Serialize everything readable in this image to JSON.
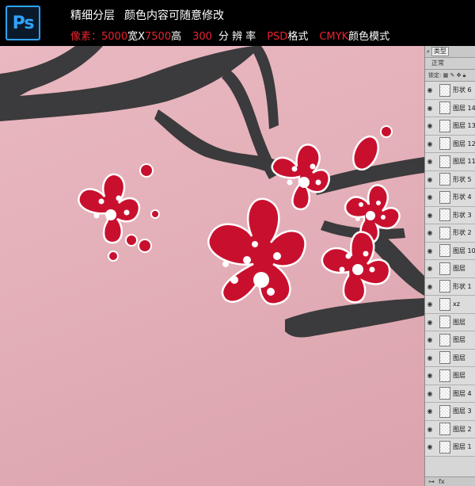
{
  "header": {
    "app_logo": "Ps",
    "title_1": "精细分层",
    "title_2": "颜色内容可随意修改",
    "pixels_label": "像素：",
    "width_value": "5000",
    "width_unit": "宽X",
    "height_value": "7500",
    "height_unit": "高",
    "resolution_value": "300",
    "resolution_label": "分 辨 率",
    "format_value": "PSD",
    "format_label": "格式",
    "colormode_value": "CMYK",
    "colormode_label": "颜色模式"
  },
  "layers_panel": {
    "filter_label": "类型",
    "blend_mode": "正常",
    "lock_label": "锁定:",
    "footer_icons": [
      "link-icon",
      "fx-icon"
    ],
    "layers": [
      {
        "name": "形状 6"
      },
      {
        "name": "图层 14"
      },
      {
        "name": "图层 13"
      },
      {
        "name": "图层 12"
      },
      {
        "name": "图层 11"
      },
      {
        "name": "形状 5"
      },
      {
        "name": "形状 4"
      },
      {
        "name": "形状 3"
      },
      {
        "name": "形状 2"
      },
      {
        "name": "图层 10"
      },
      {
        "name": "图层"
      },
      {
        "name": "形状 1"
      },
      {
        "name": "xz"
      },
      {
        "name": "图层"
      },
      {
        "name": "图层"
      },
      {
        "name": "图层"
      },
      {
        "name": "图层"
      },
      {
        "name": "图层 4"
      },
      {
        "name": "图层 3"
      },
      {
        "name": "图层 2"
      },
      {
        "name": "图层 1"
      }
    ]
  },
  "colors": {
    "banner_bg": "#000000",
    "accent_red": "#e8232f",
    "canvas_pink": "#e4b0b9",
    "branch": "#3b3a3c",
    "blossom": "#c8102e",
    "ps_blue": "#2fa3ff"
  }
}
